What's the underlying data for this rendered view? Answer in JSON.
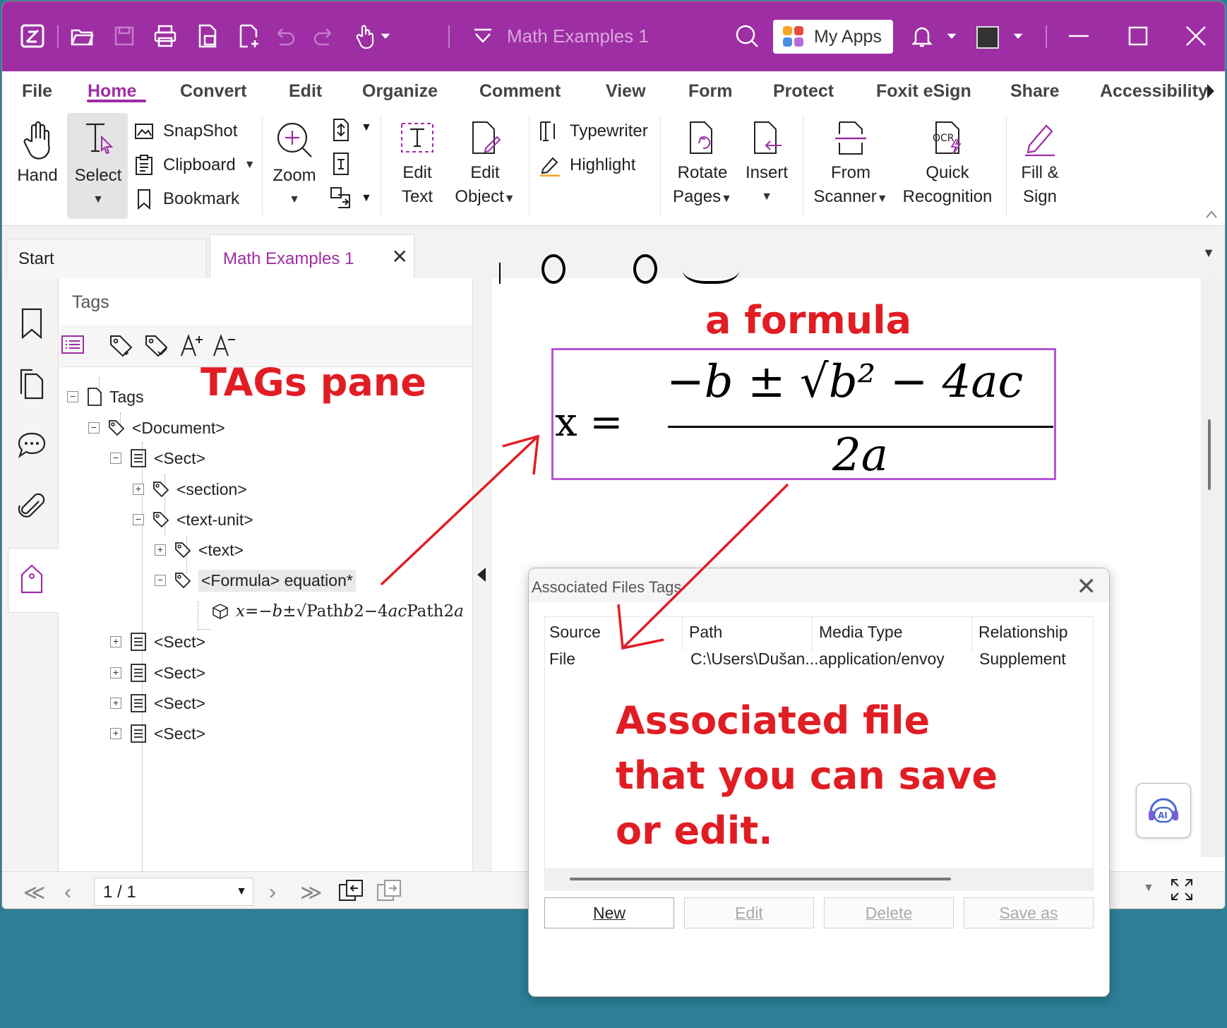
{
  "titlebar": {
    "doc_title": "Math Examples 1",
    "my_apps_label": "My Apps",
    "accent": "#9e2ea4"
  },
  "menu": [
    "File",
    "Home",
    "Convert",
    "Edit",
    "Organize",
    "Comment",
    "View",
    "Form",
    "Protect",
    "Foxit eSign",
    "Share",
    "Accessibility"
  ],
  "active_menu": "Home",
  "ribbon": {
    "hand": "Hand",
    "select": "Select",
    "snapshot": "SnapShot",
    "clipboard": "Clipboard",
    "bookmark": "Bookmark",
    "zoom": "Zoom",
    "edit_text_1": "Edit",
    "edit_text_2": "Text",
    "edit_object_1": "Edit",
    "edit_object_2": "Object",
    "typewriter": "Typewriter",
    "highlight": "Highlight",
    "rotate_1": "Rotate",
    "rotate_2": "Pages",
    "insert": "Insert",
    "scanner_1": "From",
    "scanner_2": "Scanner",
    "ocr_1": "Quick",
    "ocr_2": "Recognition",
    "fill_1": "Fill &",
    "fill_2": "Sign"
  },
  "tabs": {
    "start": "Start",
    "doc": "Math Examples 1"
  },
  "tags_pane": {
    "title": "Tags",
    "tree": [
      {
        "label": "Tags",
        "toggle": "−",
        "icon": "page-icon"
      },
      {
        "label": "<Document>",
        "toggle": "−",
        "icon": "tag-icon"
      },
      {
        "label": "<Sect>",
        "toggle": "−",
        "icon": "sect-icon"
      },
      {
        "label": "<section>",
        "toggle": "+",
        "icon": "tag-icon"
      },
      {
        "label": "<text-unit>",
        "toggle": "−",
        "icon": "tag-icon"
      },
      {
        "label": "<text>",
        "toggle": "+",
        "icon": "tag-icon"
      },
      {
        "label": "<Formula> equation*",
        "toggle": "−",
        "icon": "tag-icon"
      },
      {
        "label": "𝑥=−𝑏±√Path𝑏2−4𝑎𝑐Path2𝑎",
        "toggle": "",
        "icon": "cube-icon"
      },
      {
        "label": "<Sect>",
        "toggle": "+",
        "icon": "sect-icon"
      },
      {
        "label": "<Sect>",
        "toggle": "+",
        "icon": "sect-icon"
      },
      {
        "label": "<Sect>",
        "toggle": "+",
        "icon": "sect-icon"
      },
      {
        "label": "<Sect>",
        "toggle": "+",
        "icon": "sect-icon"
      }
    ]
  },
  "annotations": {
    "tags_pane": "TAGs pane",
    "formula": "a formula",
    "assoc_1": "Associated file",
    "assoc_2": "that you can save",
    "assoc_3": "or edit.",
    "color": "#e11d24"
  },
  "formula": {
    "lhs": "x =",
    "numerator": "−b ± √b² − 4ac",
    "denominator": "2a"
  },
  "statusbar": {
    "page": "1 / 1"
  },
  "dialog": {
    "title": "Associated Files Tags",
    "columns": [
      "Source",
      "Path",
      "Media Type",
      "Relationship"
    ],
    "rows": [
      [
        "File",
        "C:\\Users\\Dušan...",
        "application/envoy",
        "Supplement"
      ]
    ],
    "buttons": {
      "new": "New",
      "edit": "Edit",
      "delete": "Delete",
      "save_as": "Save as"
    }
  },
  "ai_label": "AI"
}
